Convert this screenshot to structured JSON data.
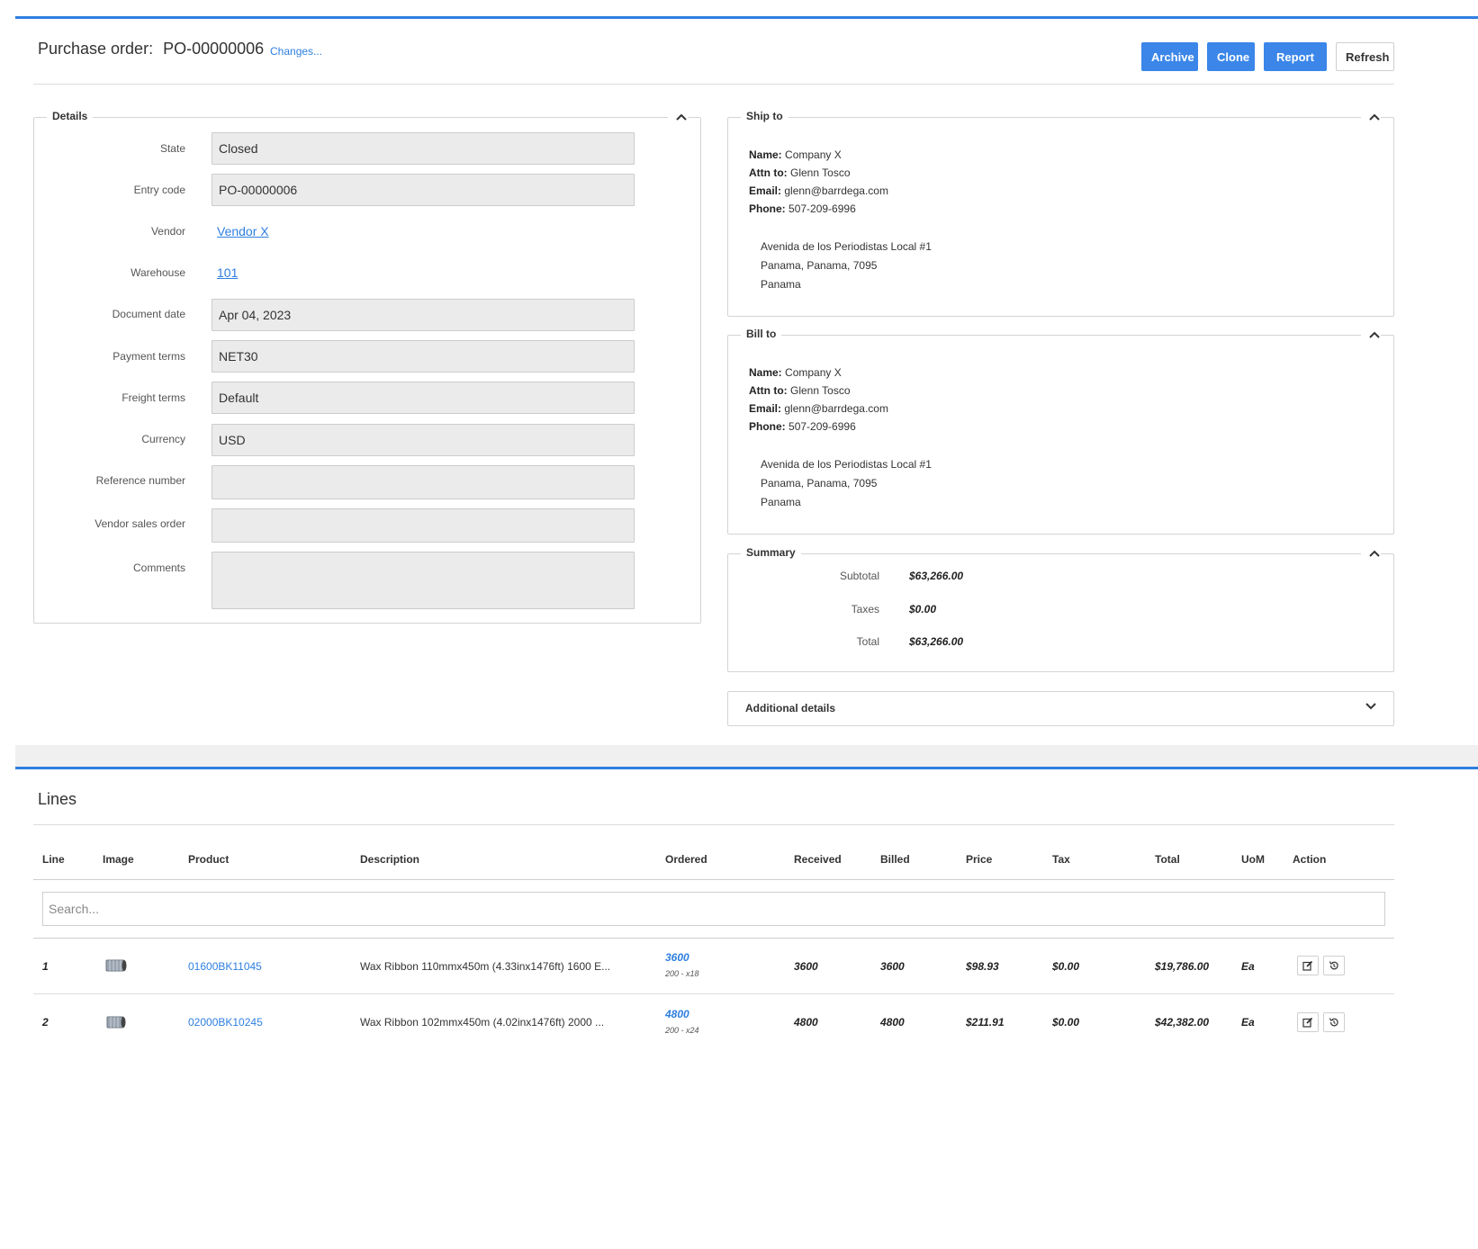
{
  "header": {
    "title_prefix": "Purchase order:",
    "title_code": "PO-00000006",
    "changes_link": "Changes...",
    "buttons": {
      "archive": "Archive",
      "clone": "Clone",
      "report": "Report",
      "refresh": "Refresh"
    }
  },
  "details": {
    "legend": "Details",
    "fields": {
      "state": {
        "label": "State",
        "value": "Closed"
      },
      "entry_code": {
        "label": "Entry code",
        "value": "PO-00000006"
      },
      "vendor": {
        "label": "Vendor",
        "value": "Vendor X"
      },
      "warehouse": {
        "label": "Warehouse",
        "value": "101"
      },
      "document_date": {
        "label": "Document date",
        "value": "Apr 04, 2023"
      },
      "payment_terms": {
        "label": "Payment terms",
        "value": "NET30"
      },
      "freight_terms": {
        "label": "Freight terms",
        "value": "Default"
      },
      "currency": {
        "label": "Currency",
        "value": "USD"
      },
      "reference_number": {
        "label": "Reference number",
        "value": ""
      },
      "vendor_sales_order": {
        "label": "Vendor sales order",
        "value": ""
      },
      "comments": {
        "label": "Comments",
        "value": ""
      }
    }
  },
  "ship_to": {
    "legend": "Ship to",
    "name_label": "Name:",
    "name": "Company X",
    "attn_label": "Attn to:",
    "attn": "Glenn Tosco",
    "email_label": "Email:",
    "email": "glenn@barrdega.com",
    "phone_label": "Phone:",
    "phone": "507-209-6996",
    "address1": "Avenida de los Periodistas Local #1",
    "address2": "Panama, Panama, 7095",
    "country": "Panama"
  },
  "bill_to": {
    "legend": "Bill to",
    "name_label": "Name:",
    "name": "Company X",
    "attn_label": "Attn to:",
    "attn": "Glenn Tosco",
    "email_label": "Email:",
    "email": "glenn@barrdega.com",
    "phone_label": "Phone:",
    "phone": "507-209-6996",
    "address1": "Avenida de los Periodistas Local #1",
    "address2": "Panama, Panama, 7095",
    "country": "Panama"
  },
  "summary": {
    "legend": "Summary",
    "subtotal_label": "Subtotal",
    "subtotal": "$63,266.00",
    "taxes_label": "Taxes",
    "taxes": "$0.00",
    "total_label": "Total",
    "total": "$63,266.00"
  },
  "additional_details": {
    "label": "Additional details"
  },
  "lines": {
    "title": "Lines",
    "columns": {
      "line": "Line",
      "image": "Image",
      "product": "Product",
      "description": "Description",
      "ordered": "Ordered",
      "received": "Received",
      "billed": "Billed",
      "price": "Price",
      "tax": "Tax",
      "total": "Total",
      "uom": "UoM",
      "action": "Action"
    },
    "search_placeholder": "Search...",
    "rows": [
      {
        "line": "1",
        "product": "01600BK11045",
        "description": "Wax Ribbon 110mmx450m (4.33inx1476ft) 1600 E...",
        "ordered": "3600",
        "ordered_sub": "200 - x18",
        "received": "3600",
        "billed": "3600",
        "price": "$98.93",
        "tax": "$0.00",
        "total": "$19,786.00",
        "uom": "Ea"
      },
      {
        "line": "2",
        "product": "02000BK10245",
        "description": "Wax Ribbon 102mmx450m (4.02inx1476ft) 2000 ...",
        "ordered": "4800",
        "ordered_sub": "200 - x24",
        "received": "4800",
        "billed": "4800",
        "price": "$211.91",
        "tax": "$0.00",
        "total": "$42,382.00",
        "uom": "Ea"
      }
    ]
  },
  "colors": {
    "accent": "#3b86e8",
    "link": "#2f7fe0",
    "input_bg": "#ebebeb"
  }
}
